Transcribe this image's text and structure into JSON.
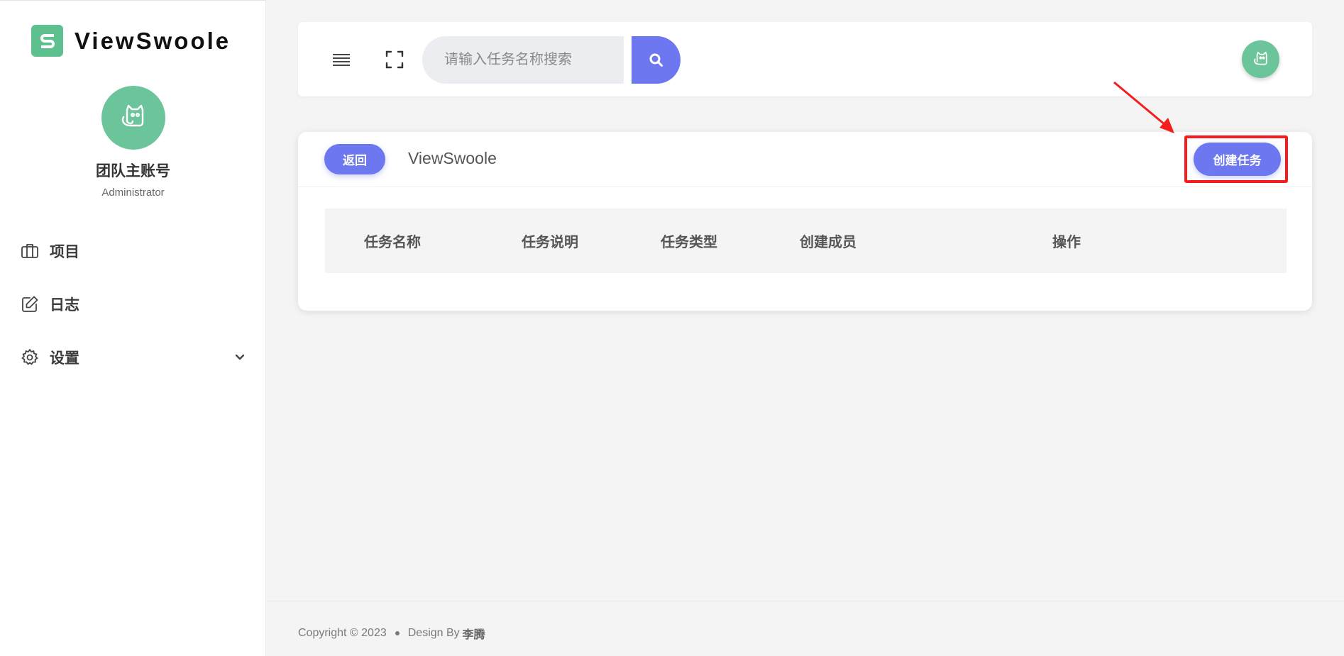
{
  "brand": {
    "logo_letter": "S",
    "name": "ViewSwoole",
    "logo_color": "#5fc08f"
  },
  "profile": {
    "name": "团队主账号",
    "role": "Administrator"
  },
  "sidebar": {
    "items": [
      {
        "label": "项目",
        "icon": "briefcase-icon"
      },
      {
        "label": "日志",
        "icon": "edit-icon"
      },
      {
        "label": "设置",
        "icon": "gear-icon",
        "has_submenu": true
      }
    ]
  },
  "header": {
    "search_placeholder": "请输入任务名称搜索"
  },
  "card": {
    "back_label": "返回",
    "title": "ViewSwoole",
    "create_label": "创建任务",
    "columns": [
      "任务名称",
      "任务说明",
      "任务类型",
      "创建成员",
      "操作"
    ]
  },
  "footer": {
    "copyright": "Copyright © 2023",
    "design_by": "Design By",
    "author": "李腾"
  },
  "colors": {
    "accent": "#6d78f0",
    "avatar": "#6cc49a",
    "annotation": "#f51d1d"
  }
}
